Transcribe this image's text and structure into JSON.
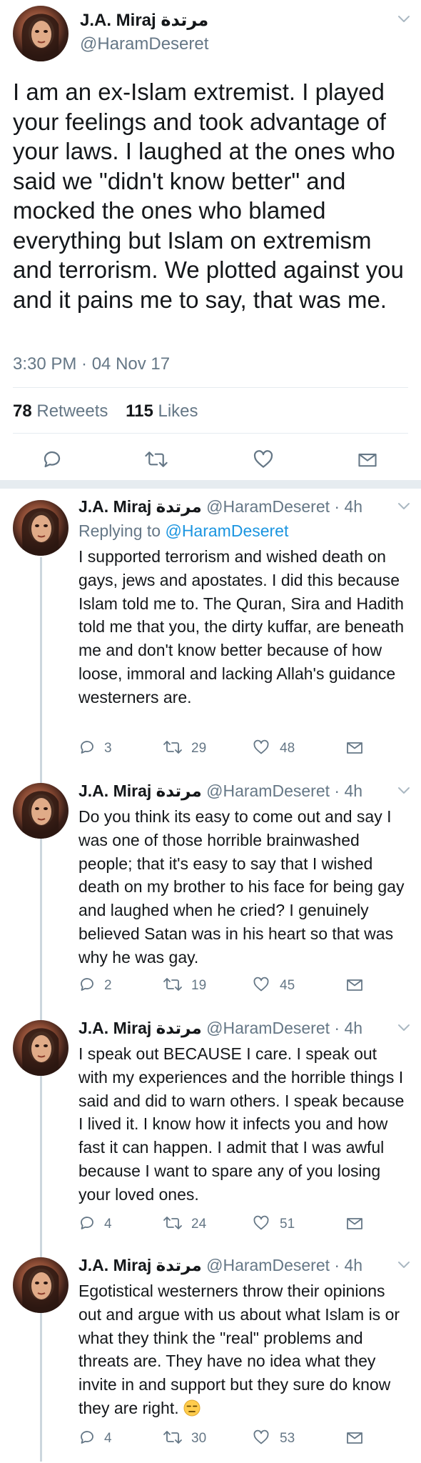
{
  "author": {
    "name": "J.A. Miraj مرتدة",
    "handle": "@HaramDeseret"
  },
  "main_tweet": {
    "text": "I am an ex-Islam extremist. I played your feelings and took advantage of your laws. I laughed at the ones who said we \"didn't know better\" and mocked the ones who blamed everything but Islam on  extremism and terrorism. We plotted against you and it pains me to say, that was me.",
    "timestamp": "3:30 PM · 04 Nov 17",
    "retweets_count": "78",
    "retweets_label": "Retweets",
    "likes_count": "115",
    "likes_label": "Likes"
  },
  "replies": [
    {
      "name": "J.A. Miraj مرتدة",
      "handle_time": "@HaramDeseret · 4h",
      "replying_label": "Replying to",
      "replying_to": "@HaramDeseret",
      "text": "I supported terrorism and wished death on gays, jews and apostates. I did this because Islam told me to. The Quran, Sira and Hadith told me that you, the dirty kuffar, are beneath me and don't know better because of how loose, immoral and lacking Allah's guidance westerners are.",
      "replies": "3",
      "retweets": "29",
      "likes": "48"
    },
    {
      "name": "J.A. Miraj مرتدة",
      "handle_time": "@HaramDeseret · 4h",
      "text": "Do you think its easy to come out and say I was one of those horrible brainwashed people; that it's easy to say that I wished death on my brother to his face for being gay and laughed when he cried? I genuinely believed Satan was in his heart so that was why he was gay.",
      "replies": "2",
      "retweets": "19",
      "likes": "45"
    },
    {
      "name": "J.A. Miraj مرتدة",
      "handle_time": "@HaramDeseret · 4h",
      "text": "I speak out BECAUSE I care. I speak out with my experiences and the horrible things I said and did to warn others. I speak because I lived it. I know how it infects you and how fast it can happen. I admit that I was awful because I want to spare any of you losing your loved ones.",
      "replies": "4",
      "retweets": "24",
      "likes": "51"
    },
    {
      "name": "J.A. Miraj مرتدة",
      "handle_time": "@HaramDeseret · 4h",
      "text": "Egotistical westerners throw their opinions out and argue with us about what Islam is or what they think the \"real\" problems and threats are. They have no idea what they invite in and support but they sure do know they are right.",
      "emoji_icon": "unamused-face-emoji",
      "replies": "4",
      "retweets": "30",
      "likes": "53"
    }
  ],
  "colors": {
    "text": "#14171a",
    "secondary": "#657786",
    "link": "#1b95e0",
    "divider": "#e6ecf0"
  }
}
